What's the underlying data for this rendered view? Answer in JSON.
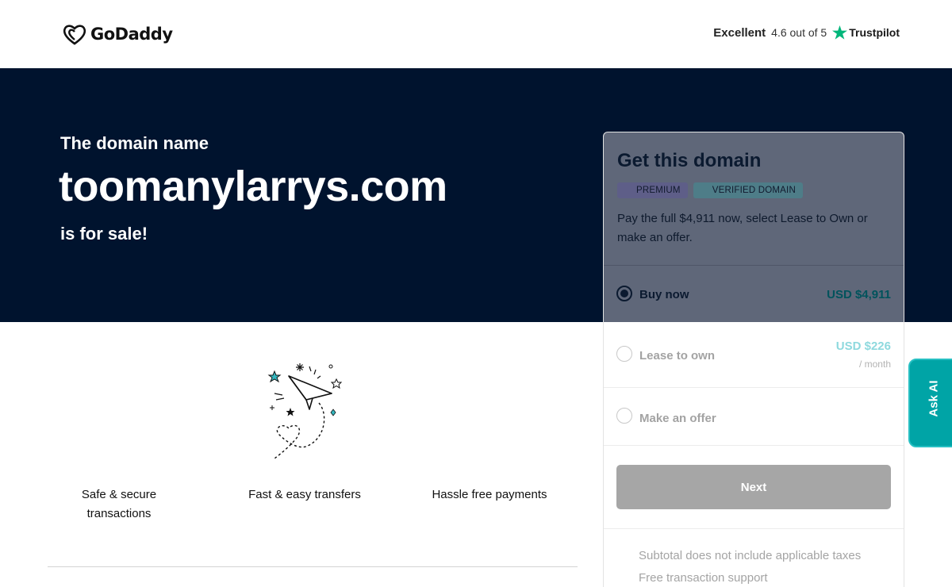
{
  "header": {
    "logo_text": "GoDaddy",
    "trust_rating_word": "Excellent",
    "trust_score": "4.6 out of 5",
    "trust_brand": "Trustpilot",
    "trust_star_color": "#00b67a"
  },
  "hero": {
    "eyebrow": "The domain name",
    "domain": "toomanylarrys.com",
    "suffix": "is for sale!"
  },
  "features": [
    {
      "label_line1": "Safe & secure",
      "label_line2": "transactions"
    },
    {
      "label_line1": "Fast & easy transfers",
      "label_line2": ""
    },
    {
      "label_line1": "Hassle free payments",
      "label_line2": ""
    }
  ],
  "card": {
    "title": "Get this domain",
    "badges": [
      "PREMIUM",
      "VERIFIED DOMAIN"
    ],
    "description": "Pay the full $4,911 now, select Lease to Own or make an offer.",
    "options": [
      {
        "label": "Buy now",
        "price": "USD $4,911",
        "subtext": "",
        "selected": true
      },
      {
        "label": "Lease to own",
        "price": "USD $226",
        "subtext": "/ month",
        "selected": false
      },
      {
        "label": "Make an offer",
        "price": "",
        "subtext": "",
        "selected": false
      }
    ],
    "next_label": "Next",
    "fine_print": [
      "Subtotal does not include applicable taxes",
      "Free transaction support"
    ]
  },
  "ask_ai": {
    "label": "Ask AI"
  },
  "colors": {
    "hero_bg": "#00132e",
    "accent_teal": "#00a4a6",
    "lease_price": "#8ed9de",
    "buy_price": "#00535c",
    "next_btn": "#a6a6a6"
  }
}
